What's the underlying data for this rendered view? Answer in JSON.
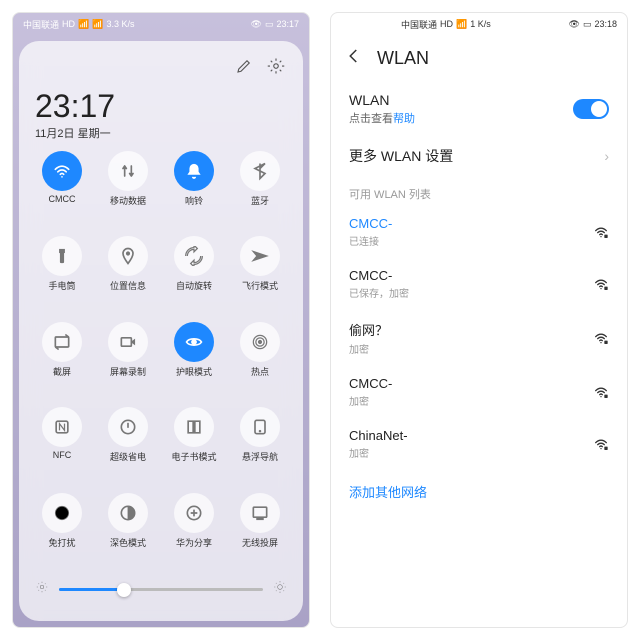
{
  "left": {
    "statusbar": {
      "carrier": "中国联通",
      "net": "HD",
      "sig": "ᴴᴰ ⁴ᴳ",
      "wifi": "",
      "speed": "3.3 K/s",
      "eye": "",
      "battery": "",
      "time": "23:17"
    },
    "bigtime": "23:17",
    "dateline": "11月2日 星期一",
    "tiles": [
      {
        "label": "CMCC",
        "on": true,
        "icon": "wifi"
      },
      {
        "label": "移动数据",
        "on": false,
        "icon": "data"
      },
      {
        "label": "响铃",
        "on": true,
        "icon": "bell"
      },
      {
        "label": "蓝牙",
        "on": false,
        "icon": "bt"
      },
      {
        "label": "手电筒",
        "on": false,
        "icon": "torch"
      },
      {
        "label": "位置信息",
        "on": false,
        "icon": "loc"
      },
      {
        "label": "自动旋转",
        "on": false,
        "icon": "rotate"
      },
      {
        "label": "飞行模式",
        "on": false,
        "icon": "plane"
      },
      {
        "label": "截屏",
        "on": false,
        "icon": "shot"
      },
      {
        "label": "屏幕录制",
        "on": false,
        "icon": "rec"
      },
      {
        "label": "护眼模式",
        "on": true,
        "icon": "eye"
      },
      {
        "label": "热点",
        "on": false,
        "icon": "hotspot"
      },
      {
        "label": "NFC",
        "on": false,
        "icon": "nfc"
      },
      {
        "label": "超级省电",
        "on": false,
        "icon": "pwr"
      },
      {
        "label": "电子书模式",
        "on": false,
        "icon": "book"
      },
      {
        "label": "悬浮导航",
        "on": false,
        "icon": "float"
      },
      {
        "label": "免打扰",
        "on": false,
        "icon": "dnd"
      },
      {
        "label": "深色模式",
        "on": false,
        "icon": "dark"
      },
      {
        "label": "华为分享",
        "on": false,
        "icon": "share"
      },
      {
        "label": "无线投屏",
        "on": false,
        "icon": "cast"
      }
    ],
    "brightness": 32
  },
  "right": {
    "statusbar": {
      "carrier": "中国联通",
      "net": "HD",
      "sig": "⁴ᴳ",
      "speed": "1 K/s",
      "time": "23:18"
    },
    "title": "WLAN",
    "wlan_label": "WLAN",
    "help_pre": "点击查看",
    "help_link": "帮助",
    "more": "更多 WLAN 设置",
    "avail": "可用 WLAN 列表",
    "nets": [
      {
        "name": "CMCC-",
        "sub": "已连接",
        "connected": true,
        "lock": true
      },
      {
        "name": "CMCC-",
        "sub": "已保存，加密",
        "connected": false,
        "lock": true
      },
      {
        "name": "偷网？",
        "sub": "加密",
        "connected": false,
        "lock": true
      },
      {
        "name": "CMCC-",
        "sub": "加密",
        "connected": false,
        "lock": true
      },
      {
        "name": "ChinaNet-",
        "sub": "加密",
        "connected": false,
        "lock": true
      }
    ],
    "add": "添加其他网络"
  }
}
